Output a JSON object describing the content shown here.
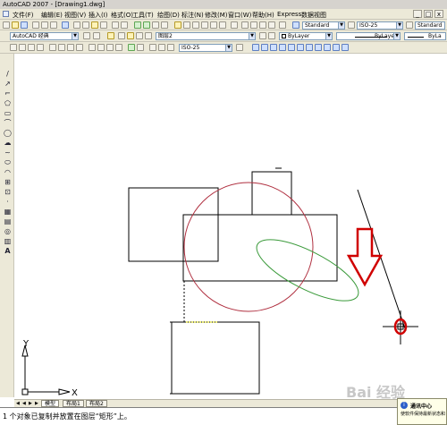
{
  "window": {
    "title": "AutoCAD 2007 - [Drawing1.dwg]"
  },
  "menubar": {
    "items": [
      "文件(F)",
      "编辑(E)",
      "视图(V)",
      "插入(I)",
      "格式(O)",
      "工具(T)",
      "绘图(D)",
      "标注(N)",
      "修改(M)",
      "窗口(W)",
      "帮助(H)",
      "Express",
      "数据视图"
    ],
    "window_controls": [
      "_",
      "□",
      "x"
    ]
  },
  "toolbar_styles": {
    "text_style": "Standard",
    "dim_style": "ISO-25",
    "table_style": "Standard"
  },
  "toolbar_layers": {
    "workspace": "AutoCAD 经典",
    "layer_combo_value": "图层2",
    "color": "ByLayer",
    "linetype": "ByLayer",
    "lineweight": "ByLa"
  },
  "toolbar_dims": {
    "dim_style": "ISO-25"
  },
  "ucs": {
    "x_label": "X",
    "y_label": "Y"
  },
  "tabs": {
    "model": "模型",
    "layout1": "布局1",
    "layout2": "布局2"
  },
  "command": {
    "line": "1 个对象已复制并放置在图层“矩形”上。"
  },
  "notification": {
    "title": "通讯中心",
    "body": "使软件保持最新状态和"
  },
  "watermark": {
    "text": "Bai 经验"
  },
  "colors": {
    "circle": "#b03040",
    "ellipse": "#3a9a3a",
    "highlight_circle": "#d00000",
    "arrow": "#d00000",
    "titlebar": "#d6d3ce",
    "toolbar_bg": "#ece9d8"
  },
  "icons": {
    "left_tools": [
      "line-icon",
      "xline-icon",
      "polyline-icon",
      "polygon-icon",
      "rectangle-icon",
      "arc-icon",
      "circle-icon",
      "revcloud-icon",
      "spline-icon",
      "ellipse-icon",
      "ellipse-arc-icon",
      "insert-block-icon",
      "make-block-icon",
      "point-icon",
      "hatch-icon",
      "gradient-icon",
      "region-icon",
      "table-icon",
      "mtext-icon"
    ]
  }
}
